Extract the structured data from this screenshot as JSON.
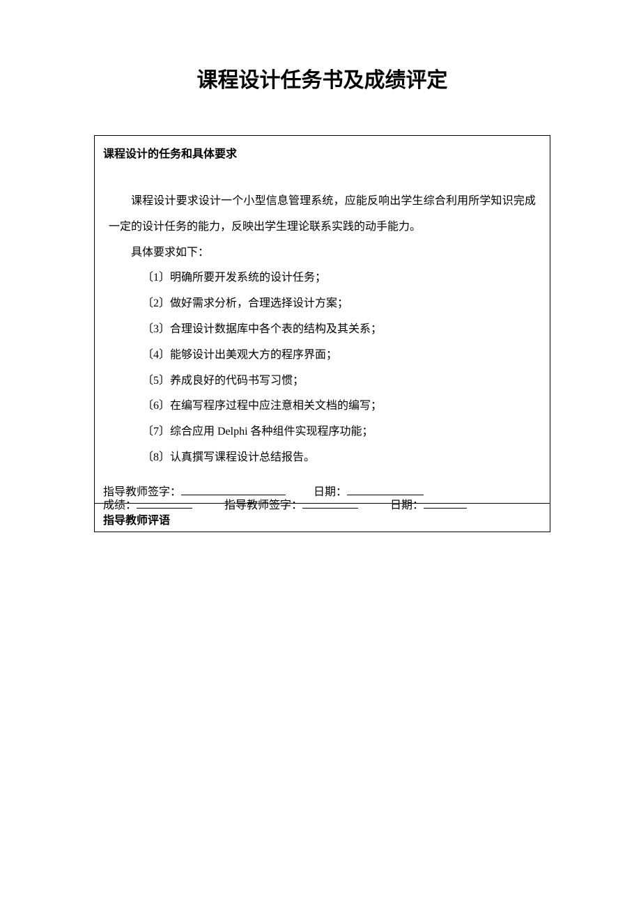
{
  "title": "课程设计任务书及成绩评定",
  "section1": {
    "header": "课程设计的任务和具体要求",
    "intro": "课程设计要求设计一个小型信息管理系统，应能反响出学生综合利用所学知识完成一定的设计任务的能力，反映出学生理论联系实践的动手能力。",
    "subheading": "具体要求如下：",
    "items": [
      "〔1〕明确所要开发系统的设计任务；",
      "〔2〕做好需求分析，合理选择设计方案；",
      "〔3〕合理设计数据库中各个表的结构及其关系；",
      "〔4〕能够设计出美观大方的程序界面；",
      "〔5〕养成良好的代码书写习惯；",
      "〔6〕在编写程序过程中应注意相关文档的编写；",
      "〔7〕综合应用 Delphi 各种组件实现程序功能；",
      "〔8〕认真撰写课程设计总结报告。"
    ],
    "signLabel": "指导教师签字：",
    "dateLabel": "日期："
  },
  "section2": {
    "header": "指导教师评语",
    "gradeLabel": "成绩：",
    "signLabel": "指导教师签字：",
    "dateLabel": "日期："
  }
}
